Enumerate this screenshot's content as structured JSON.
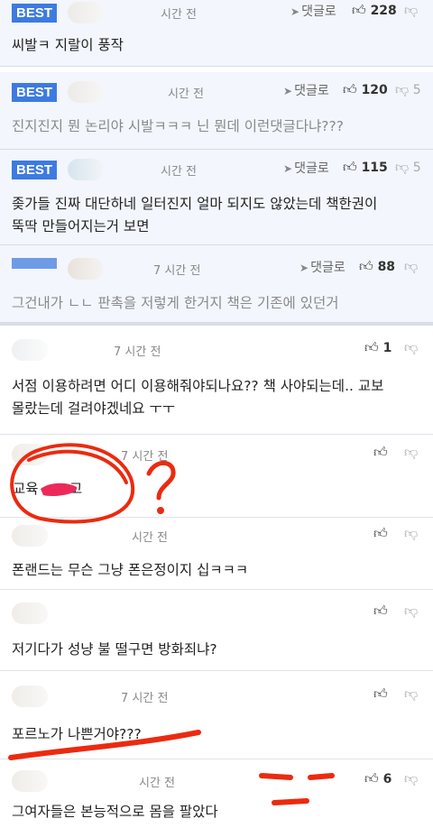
{
  "best_label": "BEST",
  "reply_label": "댓글로",
  "icons": {
    "reply": "reply-arrow-icon",
    "like": "thumbs-up-icon",
    "dislike": "thumbs-down-icon"
  },
  "colors": {
    "best_badge": "#3d7be0",
    "best_bg": "#f3f6fc",
    "scribble": "#ec2a0f"
  },
  "comments": [
    {
      "time": "시간 전",
      "likes": "228",
      "dislikes": "",
      "text": "씨발ㅋ 지랄이 풍작"
    },
    {
      "time": "시간 전",
      "likes": "120",
      "dislikes": "5",
      "text": "진지진지 뭔 논리야 시발ㅋㅋㅋ 닌 뭔데 이런댓글다냐???"
    },
    {
      "time": "시간 전",
      "likes": "115",
      "dislikes": "5",
      "text": "좆가들 진짜 대단하네 일터진지 얼마 되지도 않았는데 책한권이\n뚝딱 만들어지는거 보면"
    },
    {
      "time": "7 시간 전",
      "likes": "88",
      "dislikes": "",
      "text": "그건내가 ㄴㄴ 판촉을 저렇게 한거지 책은 기존에 있던거"
    },
    {
      "time": "7 시간 전",
      "likes": "1",
      "dislikes": "",
      "text": "서점 이용하려면 어디 이용해줘야되나요?? 책 사야되는데.. 교보\n몰랐는데 걸려야겠네요 ㅜㅜ"
    },
    {
      "time": "7 시간 전",
      "likes": "",
      "dislikes": "",
      "text": "교육       고"
    },
    {
      "time": "시간 전",
      "likes": "",
      "dislikes": "",
      "text": "폰랜드는 무슨 그냥 폰은정이지 십ㅋㅋㅋ"
    },
    {
      "time": "",
      "likes": "",
      "dislikes": "",
      "text": "저기다가 성냥 불 떨구면 방화죄냐?"
    },
    {
      "time": "7 시간 전",
      "likes": "",
      "dislikes": "",
      "text": "포르노가 나쁜거야???"
    },
    {
      "time": "시간 전",
      "likes": "6",
      "dislikes": "",
      "text": "그여자들은 본능적으로 몸을 팔았다"
    }
  ]
}
